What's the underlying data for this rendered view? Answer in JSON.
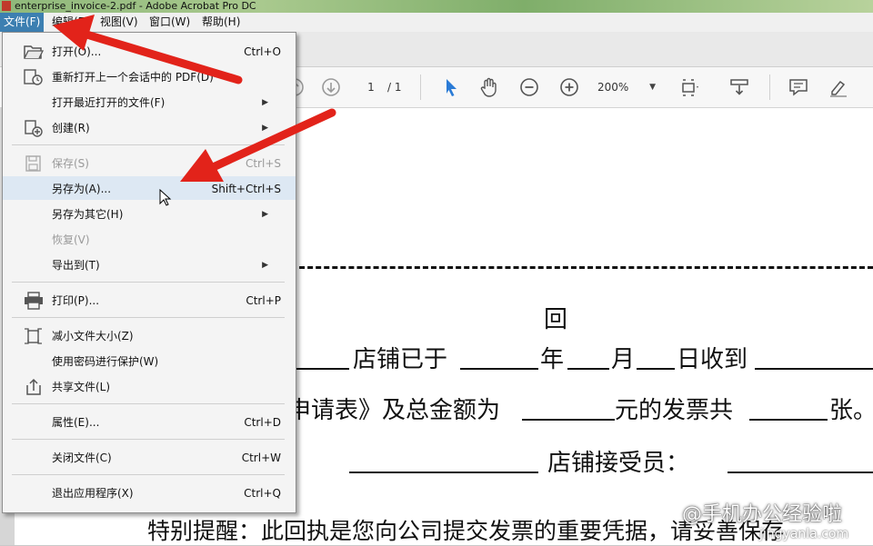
{
  "window": {
    "title": "enterprise_invoice-2.pdf - Adobe Acrobat Pro DC"
  },
  "menubar": [
    {
      "label": "文件(F)",
      "active": true
    },
    {
      "label": "编辑(E)"
    },
    {
      "label": "视图(V)"
    },
    {
      "label": "窗口(W)"
    },
    {
      "label": "帮助(H)"
    }
  ],
  "toolbar": {
    "page_current": "1",
    "page_total": "/ 1",
    "zoom": "200%"
  },
  "file_menu": {
    "items": [
      {
        "label": "打开(O)...",
        "shortcut": "Ctrl+O",
        "icon": "folder-open-icon"
      },
      {
        "label": "重新打开上一个会话中的 PDF(D)",
        "shortcut": "",
        "icon": "reopen-icon"
      },
      {
        "label": "打开最近打开的文件(F)",
        "shortcut": "",
        "submenu": true
      },
      {
        "label": "创建(R)",
        "shortcut": "",
        "submenu": true,
        "icon": "create-pdf-icon"
      },
      {
        "label": "保存(S)",
        "shortcut": "Ctrl+S",
        "disabled": true,
        "icon": "save-icon"
      },
      {
        "label": "另存为(A)...",
        "shortcut": "Shift+Ctrl+S",
        "hover": true
      },
      {
        "label": "另存为其它(H)",
        "shortcut": "",
        "submenu": true
      },
      {
        "label": "恢复(V)",
        "shortcut": "",
        "disabled": true
      },
      {
        "label": "导出到(T)",
        "shortcut": "",
        "submenu": true
      },
      {
        "label": "打印(P)...",
        "shortcut": "Ctrl+P",
        "icon": "printer-icon"
      },
      {
        "label": "减小文件大小(Z)",
        "shortcut": "",
        "icon": "reduce-size-icon"
      },
      {
        "label": "使用密码进行保护(W)",
        "shortcut": ""
      },
      {
        "label": "共享文件(L)",
        "shortcut": "",
        "icon": "share-icon"
      },
      {
        "label": "属性(E)...",
        "shortcut": "Ctrl+D"
      },
      {
        "label": "关闭文件(C)",
        "shortcut": "Ctrl+W"
      },
      {
        "label": "退出应用程序(X)",
        "shortcut": "Ctrl+Q"
      }
    ]
  },
  "document": {
    "receipt_title": "回",
    "line1": [
      "店铺已于",
      "年",
      "月",
      "日收到"
    ],
    "line2": [
      "申请表》及总金额为",
      "元的发票共",
      "张。"
    ],
    "line3": [
      "店铺接受员："
    ],
    "line4": "特别提醒：此回执是您向公司提交发票的重要凭据，请妥善保存"
  },
  "watermark": {
    "text": "@手机办公经验啦",
    "sub": "jingyanla.com"
  },
  "colors": {
    "arrow": "#e2231a",
    "menu_hover": "#dde8f3",
    "menubar_active": "#3c7fb1"
  }
}
